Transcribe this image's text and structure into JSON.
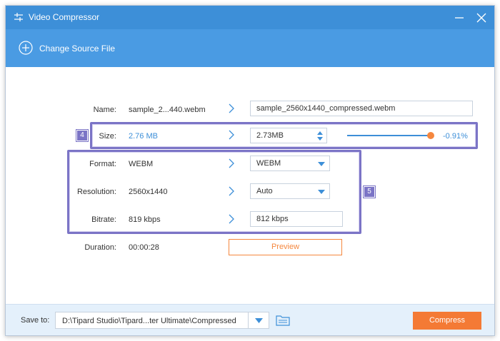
{
  "window": {
    "title": "Video Compressor"
  },
  "toolbar": {
    "change_source_label": "Change Source File"
  },
  "form": {
    "name": {
      "label": "Name:",
      "source": "sample_2...440.webm",
      "output": "sample_2560x1440_compressed.webm"
    },
    "size": {
      "label": "Size:",
      "source": "2.76 MB",
      "output": "2.73MB",
      "percent": "-0.91%",
      "slider_fraction": 0.99
    },
    "format": {
      "label": "Format:",
      "source": "WEBM",
      "output": "WEBM"
    },
    "resolution": {
      "label": "Resolution:",
      "source": "2560x1440",
      "output": "Auto"
    },
    "bitrate": {
      "label": "Bitrate:",
      "source": "819 kbps",
      "output": "812 kbps"
    },
    "duration": {
      "label": "Duration:",
      "source": "00:00:28"
    },
    "preview_label": "Preview"
  },
  "annotations": {
    "badge_4": "4",
    "badge_5": "5"
  },
  "footer": {
    "save_to_label": "Save to:",
    "path": "D:\\Tipard Studio\\Tipard...ter Ultimate\\Compressed",
    "compress_label": "Compress"
  },
  "colors": {
    "titlebar": "#3d8fd8",
    "accent_blue": "#3d8fd8",
    "accent_orange": "#f5873e",
    "annotation": "#7b74c6"
  },
  "icons": {
    "app": "sliders-icon",
    "minimize": "minimize-icon",
    "close": "close-icon",
    "add": "plus-circle-icon",
    "arrow": "chevron-right-icon",
    "dropdown": "chevron-down-icon",
    "folder": "folder-icon"
  }
}
